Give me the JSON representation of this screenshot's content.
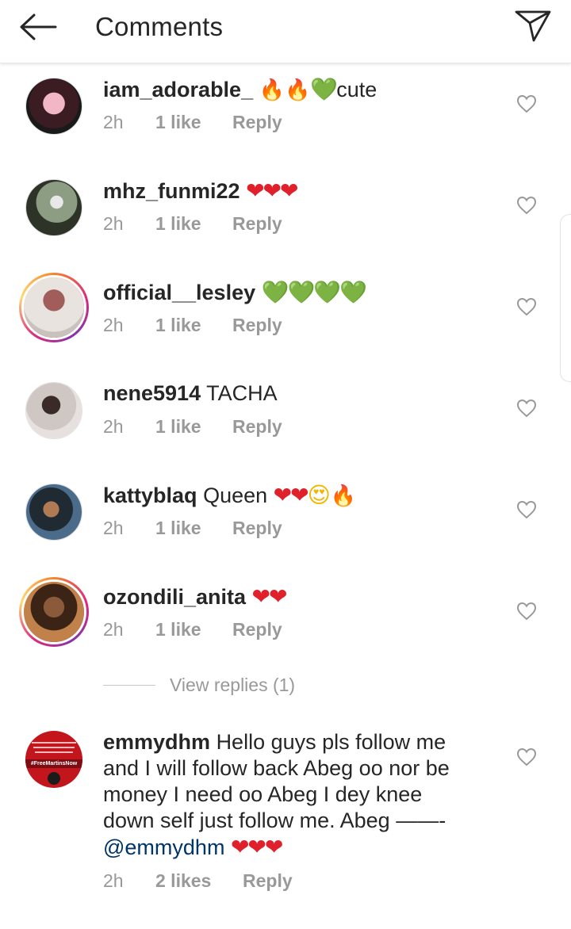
{
  "header": {
    "title": "Comments",
    "back_icon": "arrow-left-icon",
    "share_icon": "paper-plane-icon"
  },
  "comments": [
    {
      "username": "iam_adorable_",
      "emoji_1": "🔥",
      "emoji_2": "🔥",
      "emoji_3": "💚",
      "text": "cute",
      "time": "2h",
      "likes": "1 like",
      "reply": "Reply",
      "avatar_ring": false,
      "avatar_colors": [
        "#f2b7c7",
        "#3a1c22"
      ]
    },
    {
      "username": "mhz_funmi22",
      "emoji_1": "❤❤❤",
      "time": "2h",
      "likes": "1 like",
      "reply": "Reply",
      "avatar_ring": false,
      "avatar_colors": [
        "#8c9d84",
        "#2e3328"
      ]
    },
    {
      "username": "official__lesley",
      "emoji_1": "💚💚💚💚",
      "time": "2h",
      "likes": "1 like",
      "reply": "Reply",
      "avatar_ring": true,
      "avatar_colors": [
        "#e8e3de",
        "#a05d5a"
      ]
    },
    {
      "username": "nene5914",
      "text": "TACHA",
      "time": "2h",
      "likes": "1 like",
      "reply": "Reply",
      "avatar_ring": false,
      "avatar_colors": [
        "#cfc7c4",
        "#3b2b28"
      ]
    },
    {
      "username": "kattyblaq",
      "text": "Queen",
      "emoji_1": "❤❤",
      "emoji_2": "😍",
      "emoji_3": "🔥",
      "time": "2h",
      "likes": "1 like",
      "reply": "Reply",
      "avatar_ring": false,
      "avatar_colors": [
        "#4a6b8a",
        "#1f2a33"
      ]
    },
    {
      "username": "ozondili_anita",
      "emoji_1": "❤❤",
      "time": "2h",
      "likes": "1 like",
      "reply": "Reply",
      "avatar_ring": true,
      "avatar_colors": [
        "#c0814b",
        "#3b2416"
      ]
    }
  ],
  "view_replies": "View replies (1)",
  "last_comment": {
    "username": "emmydhm",
    "text": "Hello guys pls follow me and I will follow back Abeg oo nor be money I need oo Abeg I dey knee down self just follow me. Abeg ——-",
    "mention": "@emmydhm",
    "emoji_1": "❤❤❤",
    "time": "2h",
    "likes": "2 likes",
    "reply": "Reply",
    "avatar_text": "#FreeMartinsNow",
    "avatar_colors": [
      "#c3151c",
      "#1b1b1b"
    ]
  },
  "colors": {
    "text": "#262626",
    "meta": "#999999",
    "mention": "#003569",
    "heart_red": "#e0202b",
    "heart_green": "#6bb82f"
  }
}
